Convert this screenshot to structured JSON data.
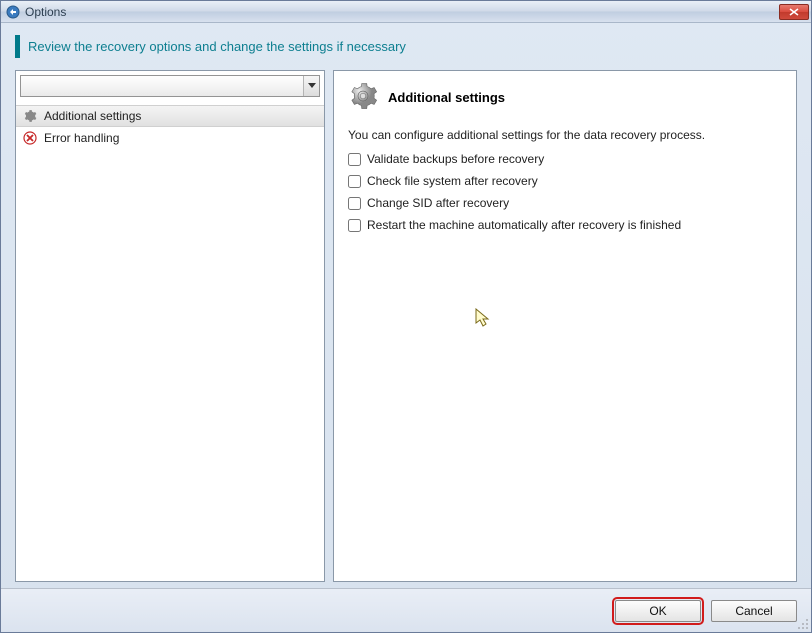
{
  "window": {
    "title": "Options"
  },
  "header": {
    "banner": "Review the recovery options and change the settings if necessary"
  },
  "nav": {
    "items": [
      {
        "label": "Additional settings",
        "selected": true,
        "icon": "gear"
      },
      {
        "label": "Error handling",
        "selected": false,
        "icon": "error"
      }
    ]
  },
  "section": {
    "title": "Additional settings",
    "description": "You can configure additional settings for the data recovery process.",
    "options": [
      {
        "label": "Validate backups before recovery",
        "checked": false
      },
      {
        "label": "Check file system after recovery",
        "checked": false
      },
      {
        "label": "Change SID after recovery",
        "checked": false
      },
      {
        "label": "Restart the machine automatically after recovery is finished",
        "checked": false
      }
    ]
  },
  "footer": {
    "ok": "OK",
    "cancel": "Cancel"
  }
}
